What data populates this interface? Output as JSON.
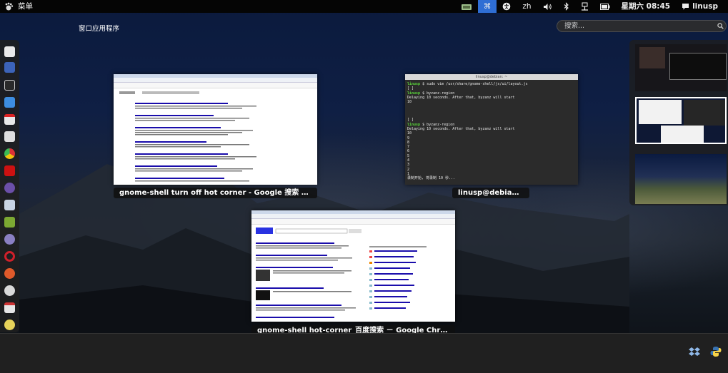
{
  "topbar": {
    "menu_label": "菜单",
    "ime_label": "zh",
    "clock": "星期六 08:45",
    "user": "linusp"
  },
  "overview": {
    "tab_label": "窗口应用程序"
  },
  "search": {
    "placeholder": "搜索..."
  },
  "dash": {
    "icons": [
      "documents-icon",
      "gnome-do-icon",
      "terminal-icon",
      "dropbox-icon",
      "gmail-icon",
      "reader-icon",
      "chrome-icon",
      "filezilla-icon",
      "emacs-icon",
      "files-icon",
      "book-icon",
      "pidgin-icon",
      "opera-icon",
      "ubuntu-one-icon",
      "bug-icon",
      "mail-icon",
      "light-icon"
    ]
  },
  "windows": [
    {
      "caption": "gnome-shell turn off hot corner - Google 搜索 － Go…",
      "app": "Google Chrome"
    },
    {
      "caption": "linusp@debian: ~",
      "app": "Terminal",
      "title": "linusp@debian: ~",
      "lines": [
        {
          "prompt": "linusp",
          "text": " $ sudo vim /usr/share/gnome-shell/js/ui/layout.js"
        },
        {
          "prompt": "",
          "text": "[ ]"
        },
        {
          "prompt": "linusp",
          "text": " $ byzanz-region"
        },
        {
          "prompt": "",
          "text": "Delaying 10 seconds. After that, byzanz will start"
        },
        {
          "prompt": "",
          "text": "10"
        },
        {
          "prompt": "",
          "text": ""
        },
        {
          "prompt": "",
          "text": ""
        },
        {
          "prompt": "",
          "text": ""
        },
        {
          "prompt": "",
          "text": "[ ]"
        },
        {
          "prompt": "linusp",
          "text": " $ byzanz-region"
        },
        {
          "prompt": "",
          "text": "Delaying 10 seconds. After that, byzanz will start"
        },
        {
          "prompt": "",
          "text": "10"
        },
        {
          "prompt": "",
          "text": "9"
        },
        {
          "prompt": "",
          "text": "8"
        },
        {
          "prompt": "",
          "text": "7"
        },
        {
          "prompt": "",
          "text": "6"
        },
        {
          "prompt": "",
          "text": "5"
        },
        {
          "prompt": "",
          "text": "4"
        },
        {
          "prompt": "",
          "text": "3"
        },
        {
          "prompt": "",
          "text": "2"
        },
        {
          "prompt": "",
          "text": "1"
        },
        {
          "prompt": "",
          "text": "录制开始, 将录制 10 秒..."
        }
      ]
    },
    {
      "caption": "gnome-shell hot-corner_百度搜索 － Google Chrome",
      "app": "Google Chrome"
    }
  ],
  "colors": {
    "active_indicator": "#2f6ed4",
    "terminal_prompt": "#59d43a"
  }
}
